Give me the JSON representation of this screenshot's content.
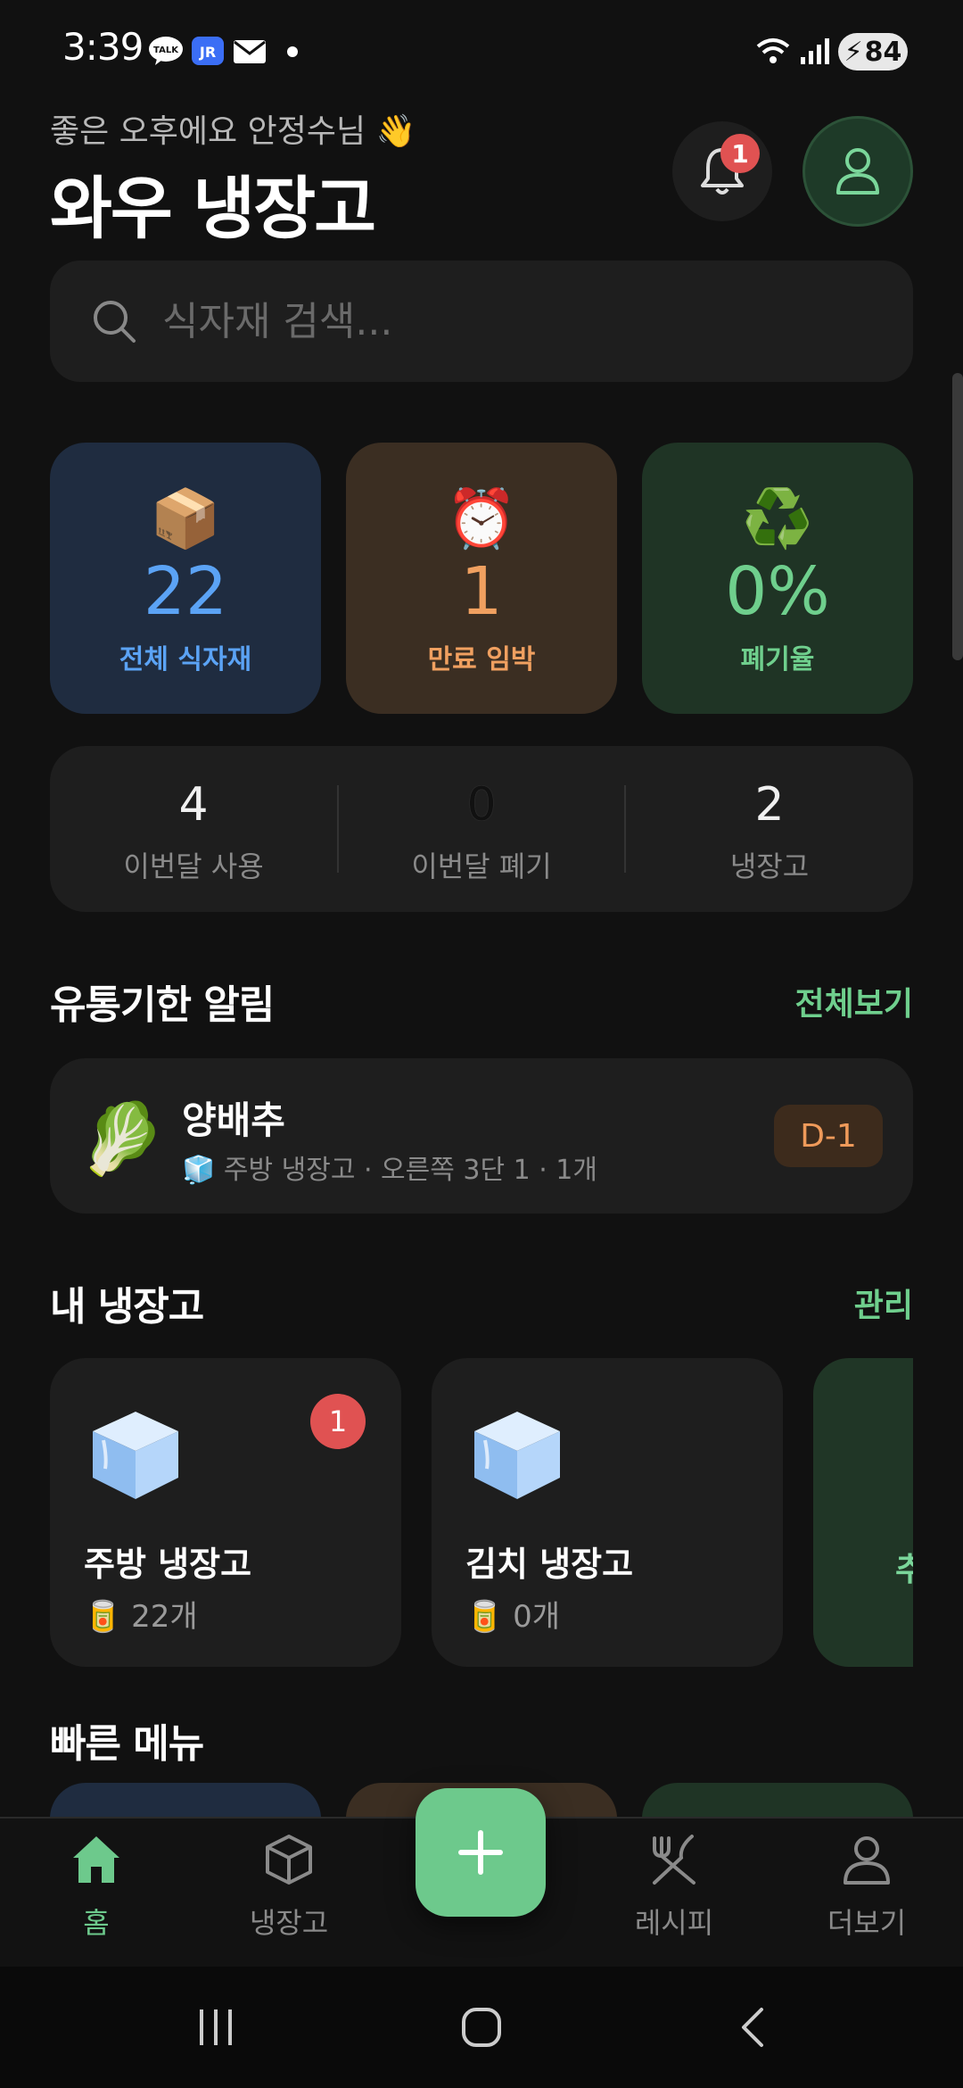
{
  "status_bar": {
    "time": "3:39",
    "battery": "84",
    "notif_icons": [
      "talk-icon",
      "jr-icon",
      "mail-icon",
      "dot-icon"
    ]
  },
  "header": {
    "greeting": "좋은 오후에요 안정수님 👋",
    "title": "와우 냉장고",
    "notification_count": "1"
  },
  "search": {
    "placeholder": "식자재 검색..."
  },
  "stats": [
    {
      "emoji": "📦",
      "value": "22",
      "label": "전체 식자재",
      "color": "#5ba3f5"
    },
    {
      "emoji": "⏰",
      "value": "1",
      "label": "만료 임박",
      "color": "#f0a060"
    },
    {
      "emoji": "♻️",
      "value": "0%",
      "label": "폐기율",
      "color": "#6fcf8d"
    }
  ],
  "summary": [
    {
      "value": "4",
      "label": "이번달 사용"
    },
    {
      "value": "0",
      "label": "이번달 폐기"
    },
    {
      "value": "2",
      "label": "냉장고"
    }
  ],
  "expiry": {
    "title": "유통기한 알림",
    "link": "전체보기",
    "item": {
      "emoji": "🥬",
      "name": "양배추",
      "meta": "주방 냉장고 · 오른쪽 3단 1 · 1개",
      "dday": "D-1"
    }
  },
  "fridges": {
    "title": "내 냉장고",
    "link": "관리",
    "items": [
      {
        "name": "주방 냉장고",
        "count": "22개",
        "badge": "1"
      },
      {
        "name": "김치 냉장고",
        "count": "0개"
      }
    ],
    "add_label": "추"
  },
  "quick_menu": {
    "title": "빠른 메뉴"
  },
  "nav": {
    "items": [
      {
        "label": "홈",
        "active": true
      },
      {
        "label": "냉장고"
      },
      {
        "label": "레시피"
      },
      {
        "label": "더보기"
      }
    ],
    "accent": "#6dc98c"
  }
}
